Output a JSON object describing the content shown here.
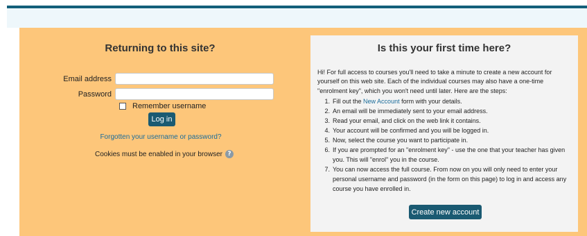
{
  "login": {
    "title": "Returning to this site?",
    "email_label": "Email address",
    "email_value": "",
    "password_label": "Password",
    "password_value": "",
    "remember_label": "Remember username",
    "remember_checked": false,
    "login_button": "Log in",
    "forgot_link": "Forgotten your username or password?",
    "cookies_text": "Cookies must be enabled in your browser",
    "help_icon": "question-circle-icon"
  },
  "signup": {
    "title": "Is this your first time here?",
    "intro": "Hi! For full access to courses you'll need to take a minute to create a new account for yourself on this web site. Each of the individual courses may also have a one-time \"enrolment key\", which you won't need until later. Here are the steps:",
    "step1_prefix": "Fill out the",
    "step1_link": "New Account",
    "step1_suffix": "form with your details.",
    "steps": [
      {
        "num": "1.",
        "text": ""
      },
      {
        "num": "2.",
        "text": "An email will be immediately sent to your email address."
      },
      {
        "num": "3.",
        "text": "Read your email, and click on the web link it contains."
      },
      {
        "num": "4.",
        "text": "Your account will be confirmed and you will be logged in."
      },
      {
        "num": "5.",
        "text": "Now, select the course you want to participate in."
      },
      {
        "num": "6.",
        "text": "If you are prompted for an \"enrolment key\" - use the one that your teacher has given you. This will \"enrol\" you in the course."
      },
      {
        "num": "7.",
        "text": "You can now access the full course. From now on you will only need to enter your personal username and password (in the form on this page) to log in and access any course you have enrolled in."
      }
    ],
    "create_button": "Create new account"
  },
  "colors": {
    "header_bar": "#135f7a",
    "panel_bg": "#fdc67a",
    "button_bg": "#1a5a72",
    "link": "#1a6c9a"
  }
}
